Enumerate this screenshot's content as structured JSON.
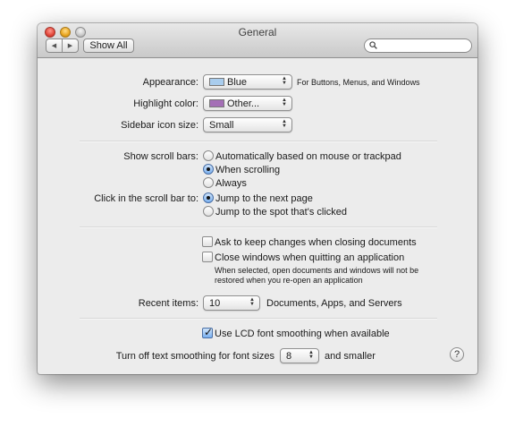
{
  "window": {
    "title": "General",
    "toolbar": {
      "back_icon": "chevron-left-icon",
      "forward_icon": "chevron-right-icon",
      "show_all_label": "Show All",
      "search_value": "",
      "search_icon": "magnifier-icon"
    }
  },
  "appearance": {
    "label": "Appearance:",
    "value": "Blue",
    "swatch_color": "#a9cdee",
    "note": "For Buttons, Menus, and Windows"
  },
  "highlight": {
    "label": "Highlight color:",
    "value": "Other...",
    "swatch_color": "#a46fb6"
  },
  "sidebar_icon_size": {
    "label": "Sidebar icon size:",
    "value": "Small"
  },
  "scroll_bars": {
    "label": "Show scroll bars:",
    "options": [
      {
        "label": "Automatically based on mouse or trackpad",
        "selected": false
      },
      {
        "label": "When scrolling",
        "selected": true
      },
      {
        "label": "Always",
        "selected": false
      }
    ]
  },
  "click_scroll": {
    "label": "Click in the scroll bar to:",
    "options": [
      {
        "label": "Jump to the next page",
        "selected": true
      },
      {
        "label": "Jump to the spot that's clicked",
        "selected": false
      }
    ]
  },
  "documents": {
    "ask_keep_changes": {
      "label": "Ask to keep changes when closing documents",
      "checked": false
    },
    "close_windows": {
      "label": "Close windows when quitting an application",
      "checked": false,
      "note_line1": "When selected, open documents and windows will not be",
      "note_line2": "restored when you re-open an application"
    }
  },
  "recent_items": {
    "label": "Recent items:",
    "value": "10",
    "suffix": "Documents, Apps, and Servers"
  },
  "lcd_smoothing": {
    "label": "Use LCD font smoothing when available",
    "checked": true
  },
  "text_smoothing": {
    "label": "Turn off text smoothing for font sizes",
    "value": "8",
    "suffix": "and smaller"
  },
  "help": {
    "label": "?"
  }
}
